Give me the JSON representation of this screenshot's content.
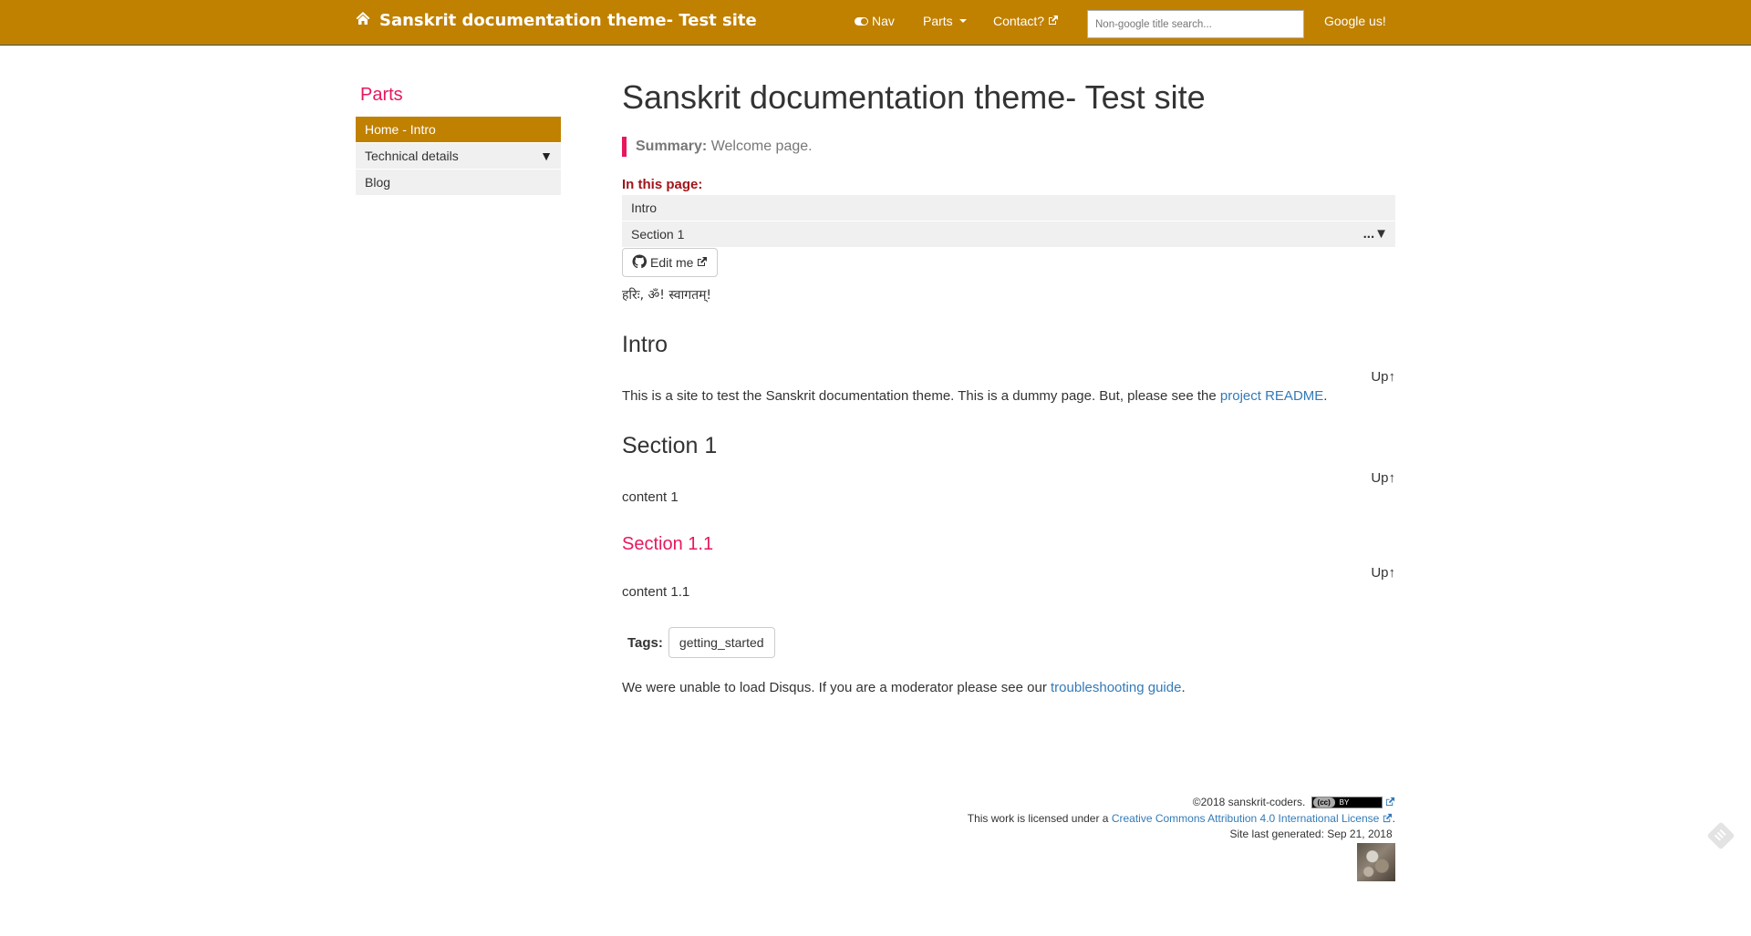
{
  "navbar": {
    "brand": "Sanskrit documentation theme- Test site",
    "brand_icon": "home-icon",
    "items": [
      {
        "label": "Nav",
        "icon": "toggle-icon"
      },
      {
        "label": "Parts",
        "icon": "caret-down-icon"
      },
      {
        "label": "Contact?",
        "icon": "external-link-icon"
      }
    ],
    "search_placeholder": "Non-google title search...",
    "search_value": "",
    "google_label": "Google us!"
  },
  "sidebar": {
    "title": "Parts",
    "items": [
      {
        "label": "Home - Intro",
        "active": true
      },
      {
        "label": "Technical details",
        "expand_icon": "▼"
      },
      {
        "label": "Blog"
      }
    ]
  },
  "main": {
    "title": "Sanskrit documentation theme- Test site",
    "summary_label": "Summary:",
    "summary_text": "Welcome page.",
    "toc_label": "In this page:",
    "toc_items": [
      {
        "label": "Intro"
      },
      {
        "label": "Section 1",
        "more": "...▼"
      }
    ],
    "edit_label": "Edit me",
    "greeting": "हरिः, ॐ! स्वागतम्!",
    "up_label": "Up↑",
    "sections": [
      {
        "heading": "Intro",
        "text": "This is a site to test the Sanskrit documentation theme. This is a dummy page. But, please see the ",
        "link": "project README",
        "after": "."
      },
      {
        "heading": "Section 1",
        "text": "content 1"
      },
      {
        "heading": "Section 1.1",
        "text": "content 1.1"
      }
    ],
    "tags_label": "Tags:",
    "tags": [
      "getting_started"
    ],
    "disqus_text": "We were unable to load Disqus. If you are a moderator please see our ",
    "disqus_link": "troubleshooting guide",
    "disqus_after": "."
  },
  "footer": {
    "copyright": "©2018 sanskrit-coders.",
    "cc_badge_left": "(cc)",
    "cc_badge_right": "BY",
    "license_prefix": "This work is licensed under a ",
    "license_link": "Creative Commons Attribution 4.0 International License",
    "license_after": ".",
    "generated": "Site last generated: Sep 21, 2018"
  },
  "colors": {
    "navbar": "#c08000",
    "accent_pink": "#e8175d",
    "toc_label": "#a0161b",
    "link": "#337ab7"
  }
}
